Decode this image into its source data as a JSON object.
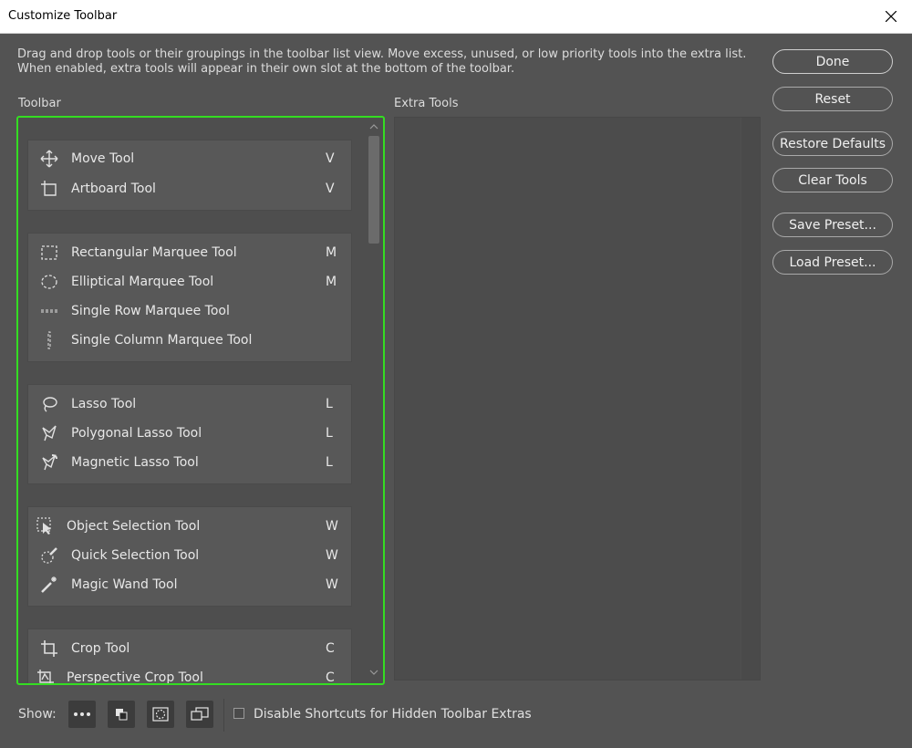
{
  "window": {
    "title": "Customize Toolbar",
    "close_icon": "close-icon"
  },
  "description": "Drag and drop tools or their groupings in the toolbar list view. Move excess, unused, or low priority tools into the extra list. When enabled, extra tools will appear in their own slot at the bottom of the toolbar.",
  "toolbar": {
    "label": "Toolbar",
    "highlight_color": "#34dd22",
    "groups": [
      {
        "tools": [
          {
            "name": "Move Tool",
            "key": "V",
            "icon": "move-icon"
          },
          {
            "name": "Artboard Tool",
            "key": "V",
            "icon": "artboard-icon"
          }
        ]
      },
      {
        "tools": [
          {
            "name": "Rectangular Marquee Tool",
            "key": "M",
            "icon": "rectangular-marquee-icon"
          },
          {
            "name": "Elliptical Marquee Tool",
            "key": "M",
            "icon": "elliptical-marquee-icon"
          },
          {
            "name": "Single Row Marquee Tool",
            "key": "",
            "icon": "single-row-marquee-icon"
          },
          {
            "name": "Single Column Marquee Tool",
            "key": "",
            "icon": "single-column-marquee-icon"
          }
        ]
      },
      {
        "tools": [
          {
            "name": "Lasso Tool",
            "key": "L",
            "icon": "lasso-icon"
          },
          {
            "name": "Polygonal Lasso Tool",
            "key": "L",
            "icon": "polygonal-lasso-icon"
          },
          {
            "name": "Magnetic Lasso Tool",
            "key": "L",
            "icon": "magnetic-lasso-icon"
          }
        ]
      },
      {
        "tools": [
          {
            "name": "Object Selection Tool",
            "key": "W",
            "icon": "object-selection-icon"
          },
          {
            "name": "Quick Selection Tool",
            "key": "W",
            "icon": "quick-selection-icon"
          },
          {
            "name": "Magic Wand Tool",
            "key": "W",
            "icon": "magic-wand-icon"
          }
        ]
      },
      {
        "tools": [
          {
            "name": "Crop Tool",
            "key": "C",
            "icon": "crop-icon"
          },
          {
            "name": "Perspective Crop Tool",
            "key": "C",
            "icon": "perspective-crop-icon"
          }
        ]
      }
    ]
  },
  "extra_tools": {
    "label": "Extra Tools"
  },
  "buttons": {
    "done": "Done",
    "reset": "Reset",
    "restore_defaults": "Restore Defaults",
    "clear_tools": "Clear Tools",
    "save_preset": "Save Preset...",
    "load_preset": "Load Preset..."
  },
  "bottom": {
    "show_label": "Show:",
    "show_buttons": [
      "more-dots-icon",
      "swap-colors-icon",
      "quick-mask-icon",
      "screen-mode-icon"
    ],
    "disable_shortcuts_label": "Disable Shortcuts for Hidden Toolbar Extras",
    "disable_shortcuts_checked": false
  }
}
